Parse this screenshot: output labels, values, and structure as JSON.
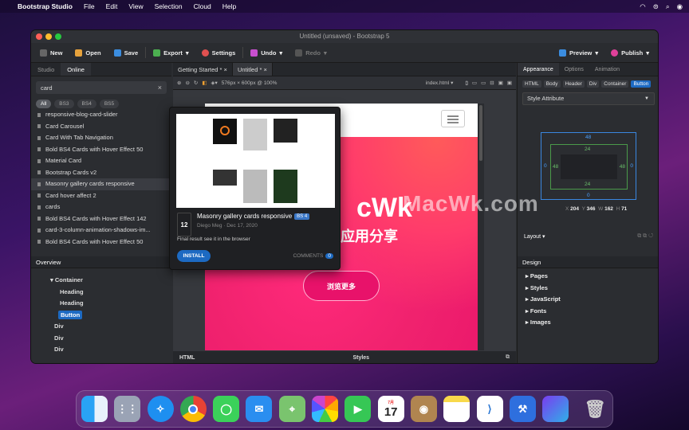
{
  "menubar": {
    "app": "Bootstrap Studio",
    "items": [
      "File",
      "Edit",
      "View",
      "Selection",
      "Cloud",
      "Help"
    ]
  },
  "window": {
    "title": "Untitled (unsaved) - Bootstrap 5"
  },
  "toolbar": {
    "new": "New",
    "open": "Open",
    "save": "Save",
    "export": "Export",
    "settings": "Settings",
    "undo": "Undo",
    "redo": "Redo",
    "preview": "Preview",
    "publish": "Publish"
  },
  "left": {
    "tabs": [
      "Studio",
      "Online"
    ],
    "search": "card",
    "filters": [
      "All",
      "BS3",
      "BS4",
      "BS5"
    ],
    "items": [
      "responsive-blog-card-slider",
      "Card Carousel",
      "Card With Tab Navigation",
      "Bold BS4 Cards with Hover Effect 50",
      "Material Card",
      "Bootstrap Cards v2",
      "Masonry gallery cards responsive",
      "Card hover affect 2",
      "cards",
      "Bold BS4 Cards with Hover Effect 142",
      "card-3-column-animation-shadows-im...",
      "Bold BS4 Cards with Hover Effect 50"
    ],
    "overview_title": "Overview",
    "tree": [
      "Container",
      "Heading",
      "Heading",
      "Button",
      "Div",
      "Div",
      "Div"
    ]
  },
  "center": {
    "tabs": [
      "Getting Started *",
      "Untitled *"
    ],
    "viewport": "576px × 600px @ 100%",
    "file": "index.html",
    "bottom_left": "HTML",
    "bottom_center": "Styles",
    "canvas": {
      "headline": "cWk",
      "subline": "应用分享",
      "button": "浏览更多"
    }
  },
  "popup": {
    "votes": "12",
    "title": "Masonry gallery cards responsive",
    "badge": "BS 4",
    "author": "Diego Meg",
    "date": "Dec 17, 2020",
    "description": "Final result see it in the browser",
    "install": "INSTALL",
    "comments_label": "COMMENTS",
    "comments": "0"
  },
  "right": {
    "tabs": [
      "Appearance",
      "Options",
      "Animation"
    ],
    "crumbs": [
      "HTML",
      "Body",
      "Header",
      "Div",
      "Container",
      "Button"
    ],
    "style_attr": "Style Attribute",
    "box": {
      "margin_top": "48",
      "margin_bottom": "0",
      "margin_left": "0",
      "margin_right": "0",
      "padding_top": "24",
      "padding_bottom": "24",
      "padding_left": "48",
      "padding_right": "48"
    },
    "dims": {
      "x": "204",
      "y": "346",
      "w": "162",
      "h": "71"
    },
    "layout": "Layout",
    "design_title": "Design",
    "design_items": [
      "Pages",
      "Styles",
      "JavaScript",
      "Fonts",
      "Images"
    ]
  },
  "dock": {
    "calendar_month": "7月",
    "calendar_day": "17"
  },
  "watermark": "MacWk.com"
}
